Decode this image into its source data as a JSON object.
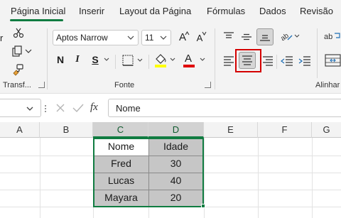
{
  "tabs": [
    "Página Inicial",
    "Inserir",
    "Layout da Página",
    "Fórmulas",
    "Dados",
    "Revisão"
  ],
  "ribbon": {
    "clipboard_label": "Transf...",
    "font_name": "Aptos Narrow",
    "font_size": "11",
    "bold": "N",
    "italic": "I",
    "underline": "S",
    "grow_font": "A",
    "shrink_font": "A",
    "font_color_letter": "A",
    "font_group_label": "Fonte",
    "align_group_label": "Alinhar",
    "accent_color": "#107c41",
    "fill_color": "#ffff00",
    "font_color": "#e00000"
  },
  "formula_bar": {
    "fx": "fx",
    "value": "Nome"
  },
  "sheet": {
    "columns": [
      "A",
      "B",
      "C",
      "D",
      "E",
      "F",
      "G"
    ],
    "header": [
      "Nome",
      "Idade"
    ],
    "rows": [
      [
        "Fred",
        "30"
      ],
      [
        "Lucas",
        "40"
      ],
      [
        "Mayara",
        "20"
      ]
    ]
  }
}
